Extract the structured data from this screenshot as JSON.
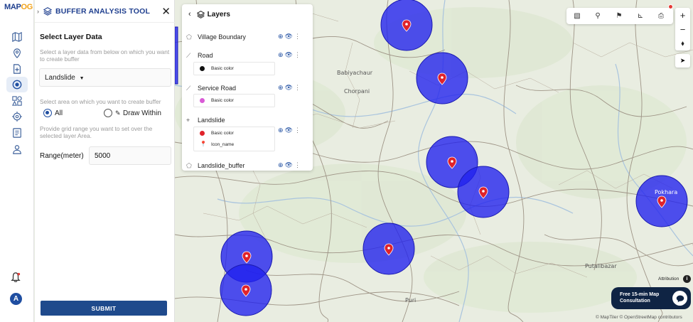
{
  "app": {
    "logo_left": "MAP",
    "logo_right": "OG"
  },
  "rail": {
    "items": [
      "map-icon",
      "location-pin-icon",
      "add-file-icon",
      "buffer-tool-icon",
      "shapes-icon",
      "target-icon",
      "report-icon",
      "person-pin-icon"
    ],
    "active_index": 3,
    "avatar_letter": "A"
  },
  "panel": {
    "title": "BUFFER ANALYSIS TOOL",
    "section_title": "Select Layer Data",
    "layer_hint": "Select a layer data from below on which you want to create buffer",
    "selected_layer": "Landslide",
    "area_hint": "Select area on which you want to create buffer",
    "option_all": "All",
    "option_draw": "Draw Within",
    "grid_hint": "Provide grid range you want to set over the selected layer Area.",
    "range_label": "Range(meter)",
    "range_value": "5000",
    "submit_label": "SUBMIT"
  },
  "layers_panel": {
    "title": "Layers",
    "items": [
      {
        "name": "Village Boundary",
        "styles": []
      },
      {
        "name": "Road",
        "styles": [
          {
            "label": "Basic color",
            "color": "#111111"
          }
        ]
      },
      {
        "name": "Service Road",
        "styles": [
          {
            "label": "Basic color",
            "color": "#d95bd6"
          }
        ]
      },
      {
        "name": "Landslide",
        "styles": [
          {
            "label": "Basic color",
            "color": "#e0232b"
          },
          {
            "label": "Icon_name",
            "color": "#111111"
          }
        ]
      },
      {
        "name": "Landslide_buffer",
        "styles": []
      }
    ]
  },
  "map": {
    "places": [
      "Babiyachaur",
      "Chorpani",
      "Pokhara",
      "Putalibazar",
      "Puri"
    ],
    "buffer_color": "#2222ee",
    "attribution_label": "Attribution",
    "consult_line1": "Free 15-min Map",
    "consult_line2": "Consultation",
    "copyright": "© MapTiler © OpenStreetMap contributors"
  }
}
